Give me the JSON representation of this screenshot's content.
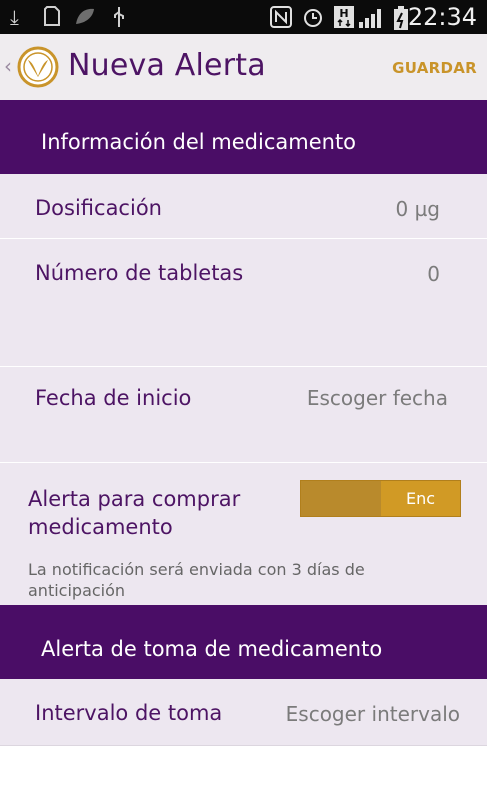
{
  "status_bar": {
    "time": "22:34",
    "icons": [
      "download-icon",
      "sd-card-icon",
      "leaf-icon",
      "usb-icon",
      "nfc-icon",
      "alarm-icon",
      "hspa-icon",
      "signal-icon",
      "battery-charging-icon"
    ]
  },
  "action_bar": {
    "title": "Nueva Alerta",
    "save_label": "GUARDAR"
  },
  "medication_section": {
    "header": "Información del medicamento",
    "dosage_label": "Dosificación",
    "dosage_value": "0 µg",
    "tablets_label": "Número de tabletas",
    "tablets_value": "0",
    "start_date_label": "Fecha de inicio",
    "start_date_value": "Escoger fecha",
    "buy_alert_label_line1": "Alerta para comprar",
    "buy_alert_label_line2": "medicamento",
    "buy_alert_toggle_label": "Enc",
    "buy_alert_enabled": true,
    "buy_alert_note": "La notificación será enviada con 3 días de anticipación"
  },
  "intake_section": {
    "header": "Alerta de toma de medicamento",
    "interval_label": "Intervalo de toma",
    "interval_value": "Escoger intervalo"
  },
  "colors": {
    "primary_purple": "#4a0d66",
    "accent_gold": "#c9942a",
    "content_bg": "#ede7f0"
  }
}
